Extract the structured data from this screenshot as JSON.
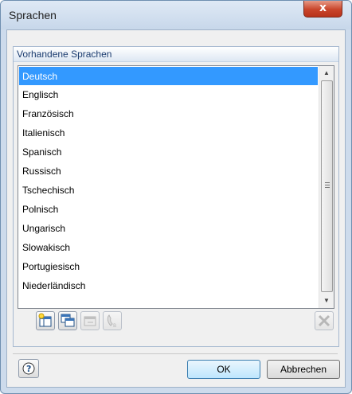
{
  "window": {
    "title": "Sprachen",
    "close_glyph": "x"
  },
  "group": {
    "title": "Vorhandene Sprachen"
  },
  "languages": [
    "Deutsch",
    "Englisch",
    "Französisch",
    "Italienisch",
    "Spanisch",
    "Russisch",
    "Tschechisch",
    "Polnisch",
    "Ungarisch",
    "Slowakisch",
    "Portugiesisch",
    "Niederländisch"
  ],
  "selected_language": "Deutsch",
  "toolbar": {
    "buttons": [
      {
        "icon": "new-language-icon",
        "enabled": true
      },
      {
        "icon": "copy-language-icon",
        "enabled": true
      },
      {
        "icon": "edit-language-icon",
        "enabled": false
      },
      {
        "icon": "phone-language-icon",
        "enabled": false
      },
      {
        "icon": "delete-icon",
        "enabled": false
      }
    ]
  },
  "footer": {
    "ok_label": "OK",
    "cancel_label": "Abbrechen",
    "help_icon": "help-icon"
  },
  "colors": {
    "selection": "#3399ff",
    "close_button": "#c9442a"
  }
}
